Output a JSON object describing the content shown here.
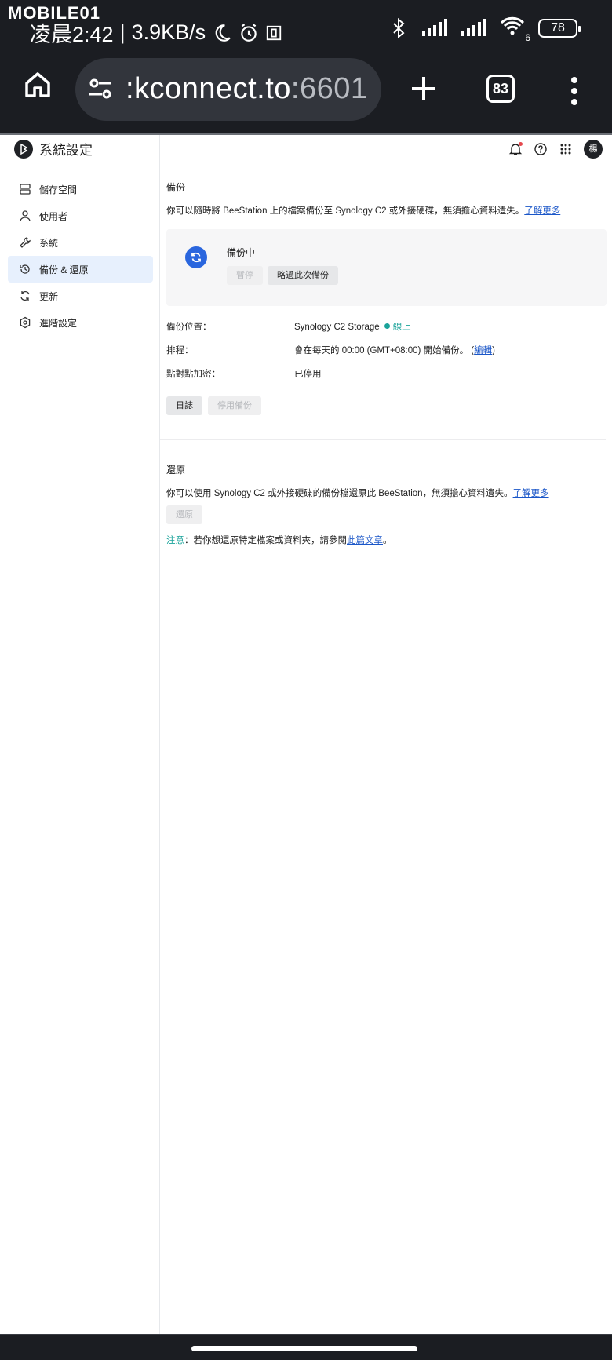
{
  "statusbar": {
    "watermark": "MOBILE01",
    "time": "凌晨2:42",
    "separator": "|",
    "speed": "3.9KB/s",
    "battery": "78",
    "signal_sub": "6"
  },
  "browser": {
    "url_main": ":kconnect.to",
    "url_port": ":6601",
    "tab_count": "83"
  },
  "app": {
    "title": "系統設定",
    "avatar_text": "楊",
    "nav": [
      {
        "label": "儲存空間",
        "icon": "storage-icon"
      },
      {
        "label": "使用者",
        "icon": "user-icon"
      },
      {
        "label": "系統",
        "icon": "wrench-icon"
      },
      {
        "label": "備份 & 還原",
        "icon": "backup-restore-icon",
        "active": true
      },
      {
        "label": "更新",
        "icon": "update-icon"
      },
      {
        "label": "進階設定",
        "icon": "advanced-settings-icon"
      }
    ]
  },
  "backup": {
    "title": "備份",
    "desc": "你可以隨時將 BeeStation 上的檔案備份至 Synology C2 或外接硬碟，無須擔心資料遺失。",
    "learn_more": "了解更多",
    "status": "備份中",
    "pause_btn": "暫停",
    "skip_btn": "略過此次備份",
    "location_label": "備份位置：",
    "location_value": "Synology C2 Storage",
    "location_status": "線上",
    "schedule_label": "排程：",
    "schedule_value": "會在每天的 00:00 (GMT+08:00) 開始備份。",
    "schedule_edit_open": "(",
    "schedule_edit": "編輯",
    "schedule_edit_close": ")",
    "encryption_label": "點對點加密：",
    "encryption_value": "已停用",
    "log_btn": "日誌",
    "disable_btn": "停用備份"
  },
  "restore": {
    "title": "還原",
    "desc": "你可以使用 Synology C2 或外接硬碟的備份檔還原此 BeeStation，無須擔心資料遺失。",
    "learn_more": "了解更多",
    "restore_btn": "還原",
    "note_label": "注意",
    "note_text": "：若你想還原特定檔案或資料夾，請參閱",
    "note_link": "此篇文章",
    "note_end": "。"
  },
  "colors": {
    "accent": "#2a66de",
    "online": "#1aa39a",
    "link": "#1a56c8",
    "active_nav": "#e7f0fd"
  }
}
